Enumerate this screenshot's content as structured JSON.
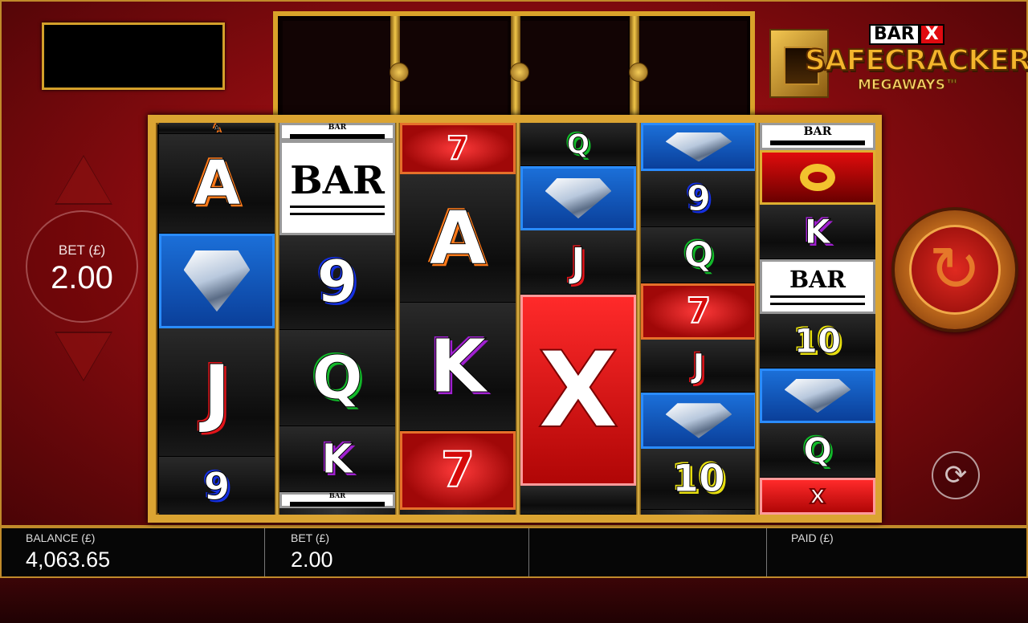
{
  "logo": {
    "bar": "BAR",
    "x": "X",
    "title": "SAFECRACKER",
    "subtitle": "MEGAWAYS™"
  },
  "bet_control": {
    "label": "BET (£)",
    "value": "2.00"
  },
  "icons": {
    "spin": "spin-arrow-icon",
    "autoplay": "autoplay-icon",
    "bet_up": "triangle-up-icon",
    "bet_down": "triangle-down-icon"
  },
  "spin_glyph": "↻",
  "autoplay_glyph": "⟳",
  "colors": {
    "frame_gold": "#dba432",
    "background_red": "#c3181a",
    "bottom_bar": "#060606"
  },
  "reels": [
    [
      {
        "t": "letter",
        "v": "A",
        "c": "#ff7a1a"
      },
      {
        "t": "letter",
        "v": "A",
        "c": "#ff7a1a"
      },
      {
        "t": "diamond",
        "v": ""
      },
      {
        "t": "letter",
        "v": "J",
        "c": "#e0141a"
      },
      {
        "t": "letter",
        "v": "9",
        "c": "#1530e0"
      }
    ],
    [
      {
        "t": "bar",
        "v": "BAR"
      },
      {
        "t": "bar",
        "v": "BAR"
      },
      {
        "t": "letter",
        "v": "9",
        "c": "#1530e0"
      },
      {
        "t": "letter",
        "v": "Q",
        "c": "#12b82a"
      },
      {
        "t": "letter",
        "v": "K",
        "c": "#a020d0"
      },
      {
        "t": "bar",
        "v": "BAR"
      }
    ],
    [
      {
        "t": "seven",
        "v": "7"
      },
      {
        "t": "letter",
        "v": "A",
        "c": "#ff7a1a"
      },
      {
        "t": "letter",
        "v": "K",
        "c": "#a020d0"
      },
      {
        "t": "seven",
        "v": "7"
      }
    ],
    [
      {
        "t": "letter",
        "v": "Q",
        "c": "#12b82a"
      },
      {
        "t": "diamond",
        "v": ""
      },
      {
        "t": "letter",
        "v": "J",
        "c": "#e0141a"
      },
      {
        "t": "xsym",
        "v": "X"
      },
      {
        "t": "letter",
        "v": "",
        "c": "#fff"
      }
    ],
    [
      {
        "t": "diamond",
        "v": ""
      },
      {
        "t": "letter",
        "v": "9",
        "c": "#1530e0"
      },
      {
        "t": "letter",
        "v": "Q",
        "c": "#12b82a"
      },
      {
        "t": "seven",
        "v": "7"
      },
      {
        "t": "letter",
        "v": "J",
        "c": "#e0141a"
      },
      {
        "t": "diamond",
        "v": ""
      },
      {
        "t": "letter",
        "v": "10",
        "c": "#e8e010"
      }
    ],
    [
      {
        "t": "bar",
        "v": "BAR"
      },
      {
        "t": "ring",
        "v": ""
      },
      {
        "t": "letter",
        "v": "K",
        "c": "#a020d0"
      },
      {
        "t": "bar",
        "v": "BAR"
      },
      {
        "t": "letter",
        "v": "10",
        "c": "#e8e010"
      },
      {
        "t": "diamond",
        "v": ""
      },
      {
        "t": "letter",
        "v": "Q",
        "c": "#12b82a"
      },
      {
        "t": "xsym",
        "v": "X"
      }
    ]
  ],
  "bottom_bar": {
    "balance": {
      "label": "BALANCE (£)",
      "value": "4,063.65"
    },
    "bet": {
      "label": "BET (£)",
      "value": "2.00"
    },
    "middle": {
      "label": "",
      "value": ""
    },
    "paid": {
      "label": "PAID (£)",
      "value": ""
    }
  }
}
